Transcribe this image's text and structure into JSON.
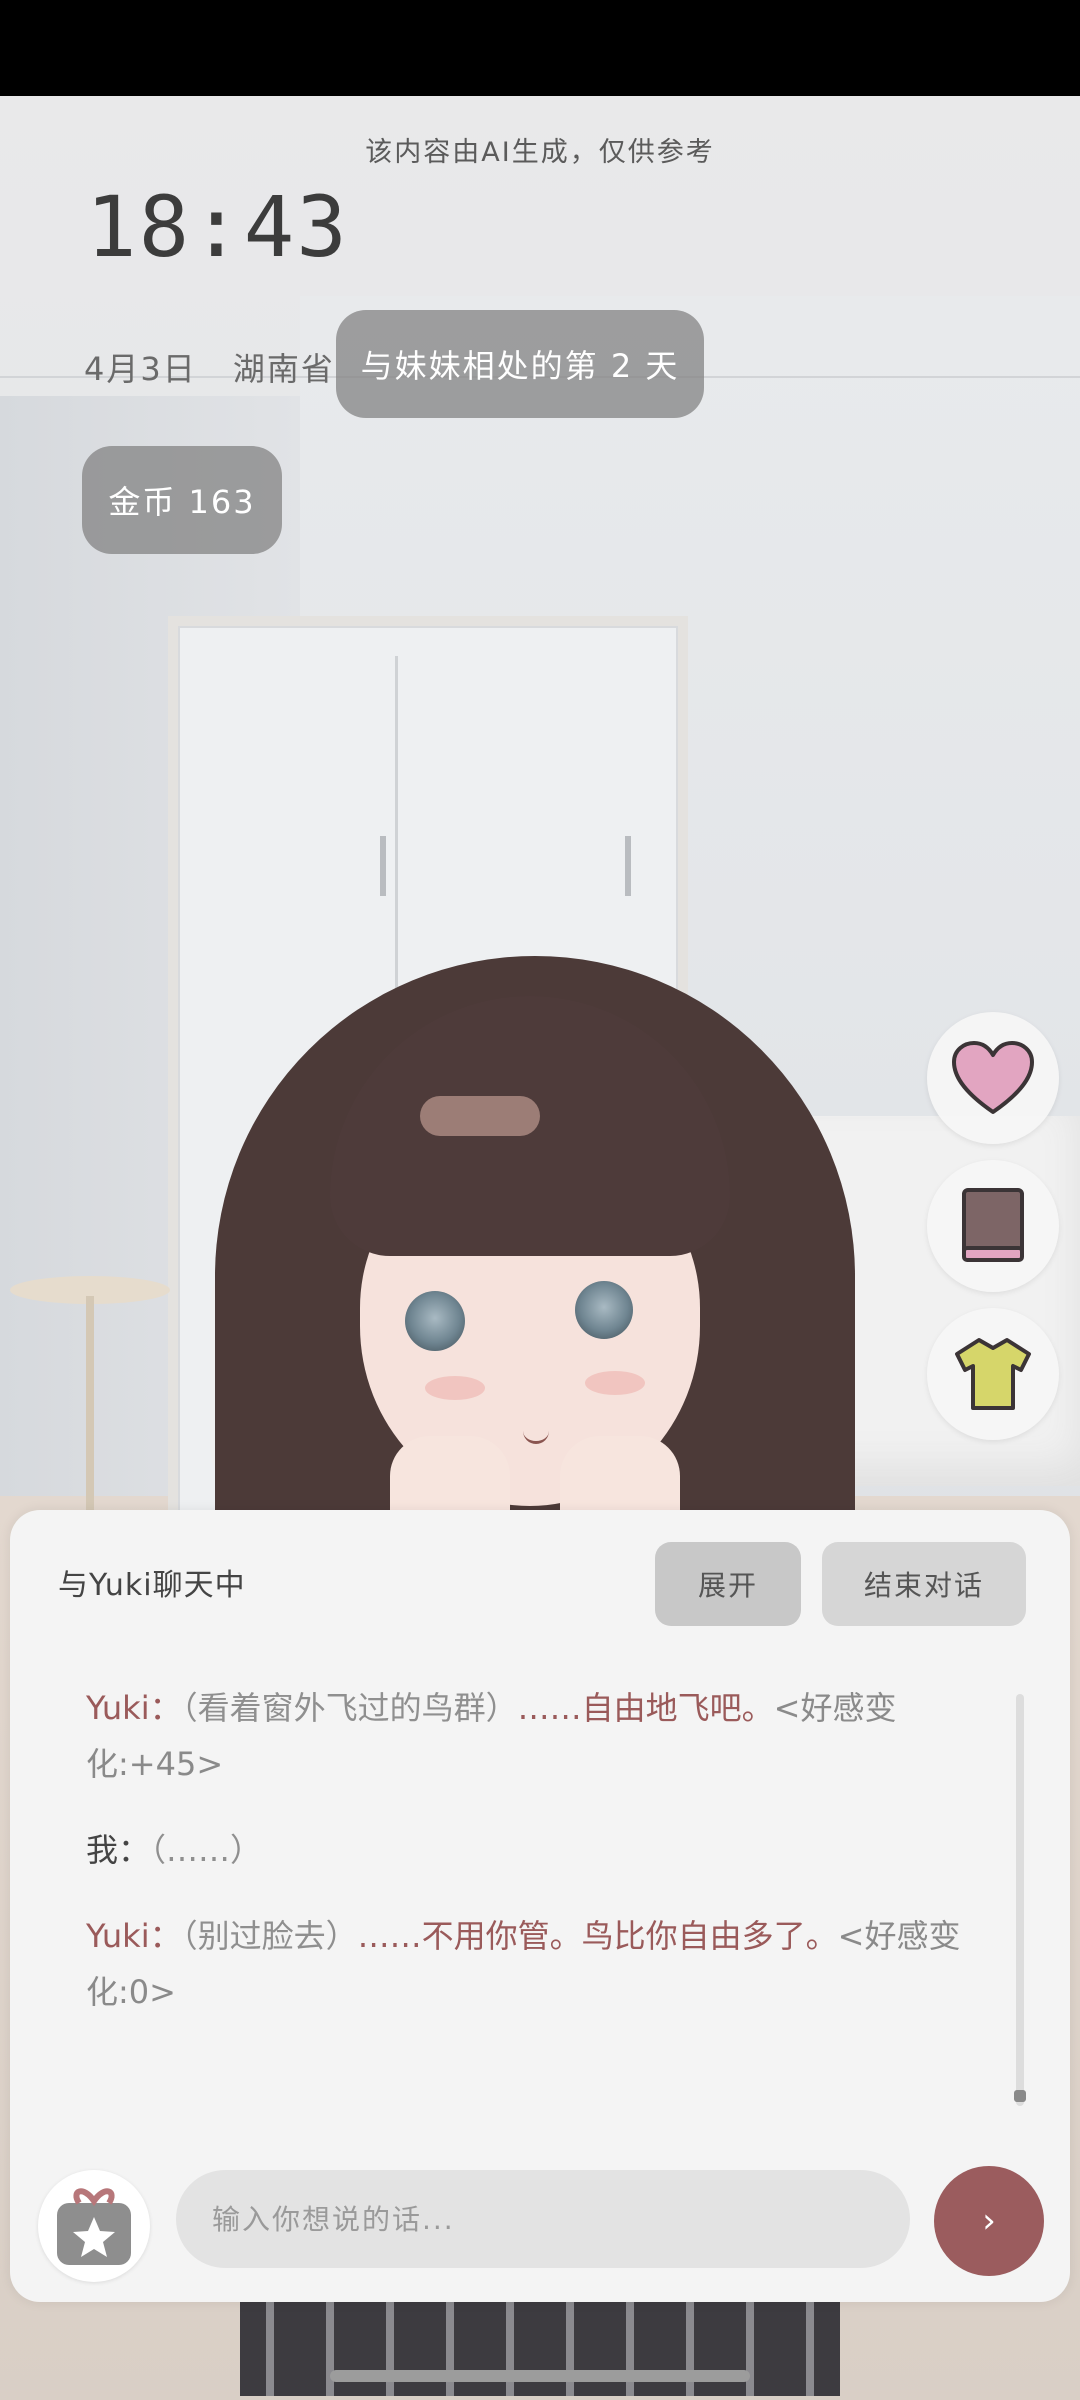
{
  "disclaimer": "该内容由AI生成，仅供参考",
  "clock": "18:43",
  "date": "4月3日",
  "location": "湖南省",
  "days_pill": "与妹妹相处的第 2 天",
  "coins_pill": "金币 163",
  "side_buttons": {
    "heart_icon": "heart-icon",
    "book_icon": "book-icon",
    "shirt_icon": "shirt-icon"
  },
  "chat": {
    "title": "与Yuki聊天中",
    "expand_label": "展开",
    "end_label": "结束对话",
    "messages": [
      {
        "speaker": "Yuki：",
        "action": "（看着窗外飞过的鸟群）",
        "speech": "……自由地飞吧。",
        "affinity": "<好感变化:+45>"
      },
      {
        "speaker": "我：",
        "action": "（……）",
        "speech": "",
        "affinity": ""
      },
      {
        "speaker": "Yuki：",
        "action": "（别过脸去）",
        "speech": "……不用你管。鸟比你自由多了。",
        "affinity": "<好感变化:0>"
      }
    ],
    "input_placeholder": "输入你想说的话...",
    "send_icon": "›"
  },
  "colors": {
    "accent": "#9b5c5e",
    "pill_bg": "#808080",
    "panel_bg": "#f4f4f4"
  }
}
